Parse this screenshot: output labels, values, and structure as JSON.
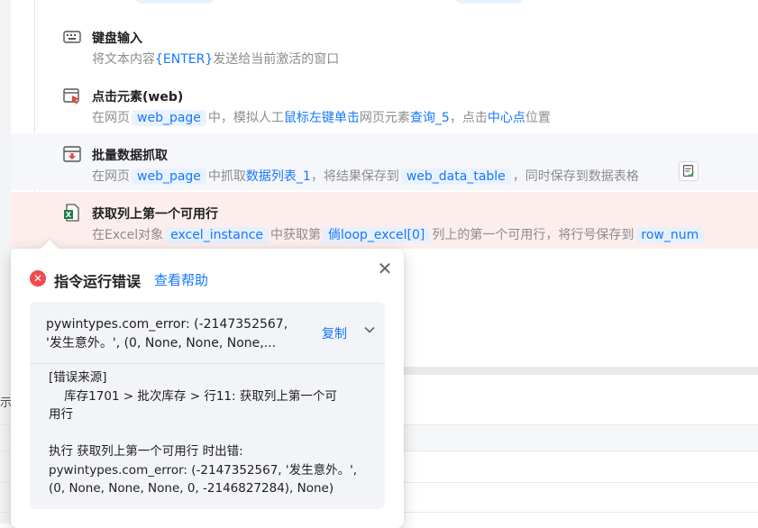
{
  "commands": [
    {
      "id": "keyboard",
      "title": "键盘输入",
      "desc": {
        "p1": "将文本内容",
        "kw1": "{ENTER}",
        "p2": "发送给当前激活的窗口"
      }
    },
    {
      "id": "click",
      "title": "点击元素(web)",
      "desc": {
        "p1": "在网页",
        "tok1": "web_page",
        "p2": "中，模拟人工",
        "kw1": "鼠标左键单击",
        "p3": "网页元素",
        "kw2": "查询_5",
        "p4": "，点击",
        "kw3": "中心点",
        "p5": "位置"
      }
    },
    {
      "id": "scrape",
      "title": "批量数据抓取",
      "desc": {
        "p1": "在网页",
        "tok1": "web_page",
        "p2": "中抓取",
        "kw1": "数据列表_1",
        "p3": "，将结果保存到",
        "tok2": "web_data_table",
        "p4": "，同时保存到数据表格"
      }
    },
    {
      "id": "excel-row",
      "title": "获取列上第一个可用行",
      "desc": {
        "p1": "在Excel对象",
        "tok1": "excel_instance",
        "p2": "中获取第",
        "tok2": "倘loop_excel[0]",
        "p3": "列上的第一个可用行，将行号保存到",
        "tok3": "row_num"
      }
    }
  ],
  "background": {
    "cut_text": "示"
  },
  "error_popup": {
    "title": "指令运行错误",
    "help_link": "查看帮助",
    "close_glyph": "✕",
    "error_icon_glyph": "✕",
    "summary": "pywintypes.com_error: (-2147352567, '发生意外。', (0, None, None, None,...",
    "copy_label": "复制",
    "detail": "[错误来源]\n    库存1701 > 批次库存 > 行11: 获取列上第一个可\n用行\n\n执行 获取列上第一个可用行 时出错:\npywintypes.com_error: (-2147352567, '发生意外。', (0, None, None, None, 0, -2146827284), None)"
  },
  "colors": {
    "accent": "#1677ff",
    "error": "#f04a4a",
    "error_row_bg": "#fdeeee",
    "selected_row_bg": "#f5f7fb"
  }
}
